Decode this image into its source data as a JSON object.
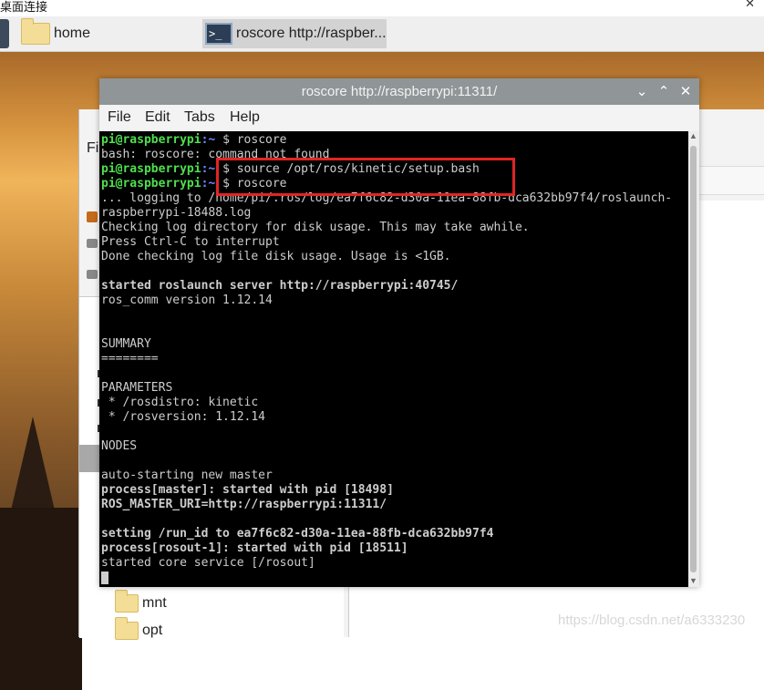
{
  "remote": {
    "title": "桌面连接",
    "close": "✕"
  },
  "taskbar": {
    "items": [
      {
        "label": "home"
      },
      {
        "label": "roscore http://raspber..."
      }
    ],
    "term_icon_glyph": ">_"
  },
  "filemanager": {
    "menu_label": "Fi",
    "tree": [
      {
        "label": "mnt"
      },
      {
        "label": "opt"
      }
    ]
  },
  "terminal": {
    "title": "roscore http://raspberrypi:11311/",
    "controls": {
      "minimize": "⌄",
      "maximize": "⌃",
      "close": "✕"
    },
    "menu": [
      "File",
      "Edit",
      "Tabs",
      "Help"
    ],
    "prompt": {
      "user": "pi@raspberrypi",
      "path": ":~ ",
      "dollar": "$ "
    },
    "commands": [
      "roscore",
      "source /opt/ros/kinetic/setup.bash",
      "roscore"
    ],
    "lines": {
      "l1": "bash: roscore: command not found",
      "l4": "... logging to /home/pi/.ros/log/ea7f6c82-d30a-11ea-88fb-dca632bb97f4/roslaunch-",
      "l5": "raspberrypi-18488.log",
      "l6": "Checking log directory for disk usage. This may take awhile.",
      "l7": "Press Ctrl-C to interrupt",
      "l8": "Done checking log file disk usage. Usage is <1GB.",
      "l10": "started roslaunch server http://raspberrypi:40745/",
      "l11": "ros_comm version 1.12.14",
      "l14": "SUMMARY",
      "l15": "========",
      "l17": "PARAMETERS",
      "l18": " * /rosdistro: kinetic",
      "l19": " * /rosversion: 1.12.14",
      "l21": "NODES",
      "l23": "auto-starting new master",
      "l24": "process[master]: started with pid [18498]",
      "l25": "ROS_MASTER_URI=http://raspberrypi:11311/",
      "l27": "setting /run_id to ea7f6c82-d30a-11ea-88fb-dca632bb97f4",
      "l28": "process[rosout-1]: started with pid [18511]",
      "l29": "started core service [/rosout]"
    }
  },
  "watermark": "https://blog.csdn.net/a6333230",
  "colors": {
    "prompt_user": "#4ee04e",
    "prompt_path": "#6f8cff",
    "annotation": "#e02525",
    "terminal_bg": "#000000"
  }
}
